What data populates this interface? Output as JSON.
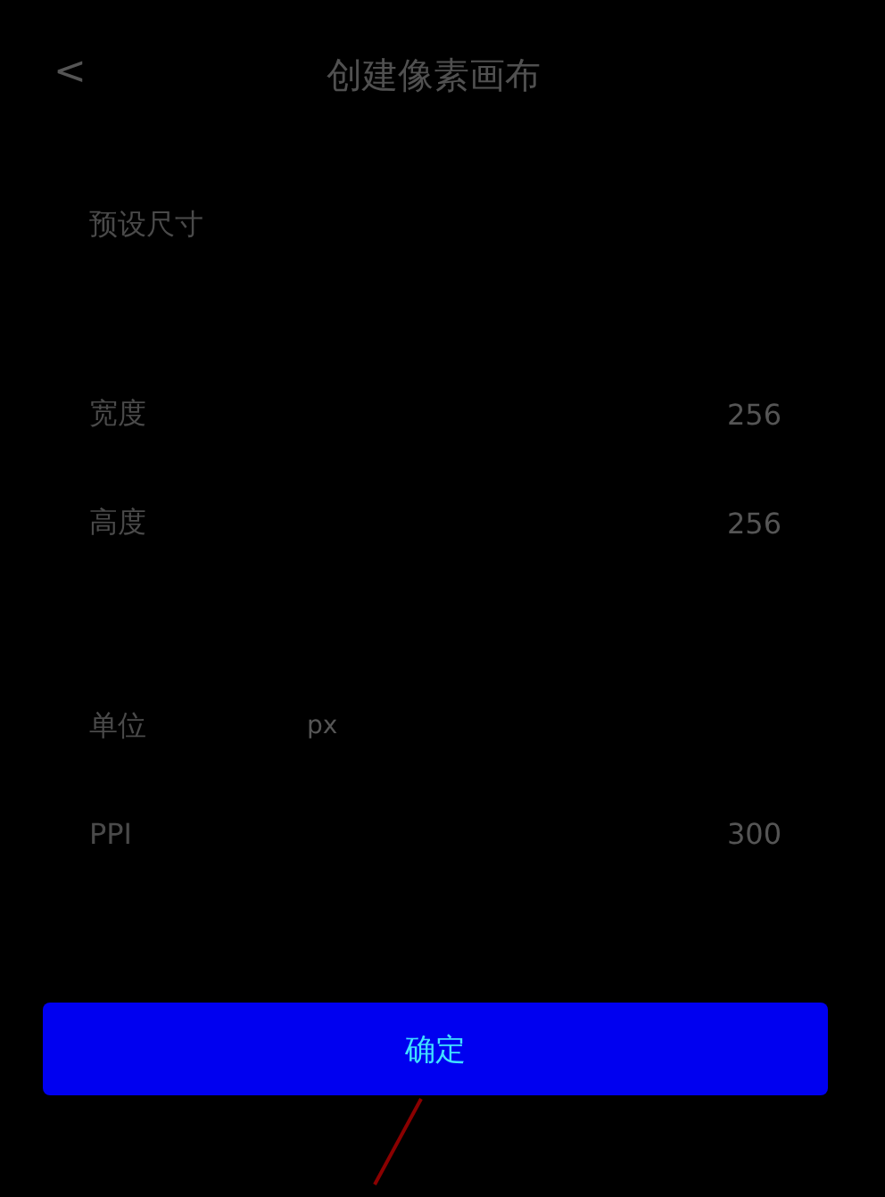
{
  "header": {
    "back": "<",
    "title": "创建像素画布"
  },
  "preset": {
    "label": "预设尺寸"
  },
  "size_rows": [
    {
      "label": "宽度",
      "value": "256"
    },
    {
      "label": "高度",
      "value": "256"
    }
  ],
  "unit": {
    "label": "单位",
    "value": "px"
  },
  "ppi": {
    "label": "PPI",
    "value": "300"
  },
  "confirm": {
    "label": "确定"
  }
}
